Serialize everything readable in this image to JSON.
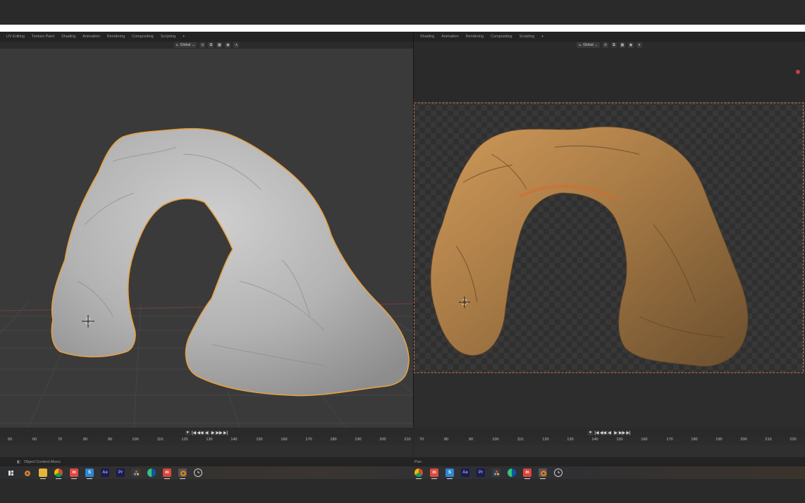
{
  "left_editor": {
    "workspace_tabs": [
      "UV Editing",
      "Texture Paint",
      "Shading",
      "Animation",
      "Rendering",
      "Compositing",
      "Scripting"
    ],
    "add_tab": "+",
    "transform_orientation": "Global",
    "timeline_ticks": [
      "50",
      "60",
      "70",
      "80",
      "90",
      "100",
      "110",
      "120",
      "130",
      "140",
      "150",
      "160",
      "170",
      "180",
      "190",
      "200",
      "210"
    ],
    "status_text": "Object Context Menu"
  },
  "right_editor": {
    "workspace_tabs": [
      "Shading",
      "Animation",
      "Rendering",
      "Compositing",
      "Scripting"
    ],
    "add_tab": "+",
    "transform_orientation": "Global",
    "timeline_ticks": [
      "70",
      "80",
      "90",
      "100",
      "110",
      "120",
      "130",
      "140",
      "150",
      "160",
      "170",
      "180",
      "190",
      "200",
      "210",
      "220"
    ],
    "status_text": "Pan"
  },
  "playback": [
    "●",
    "|◀",
    "◀◀",
    "◀",
    "▶",
    "▶▶",
    "▶|"
  ],
  "taskbar": {
    "left_icons": [
      "task-view-icon",
      "blender-icon",
      "file-explorer-icon",
      "chrome-icon",
      "mail-icon",
      "store-icon",
      "after-effects-icon",
      "premiere-icon",
      "davinci-icon",
      "edge-icon",
      "news-icon",
      "blender-active-icon",
      "clock-icon"
    ],
    "right_icons": [
      "chrome-icon",
      "mail-icon",
      "store-icon",
      "after-effects-icon",
      "premiere-icon",
      "davinci-icon",
      "edge-icon",
      "news-icon",
      "blender-active-icon",
      "clock-icon"
    ],
    "labels": {
      "after_effects": "Ae",
      "premiere": "Pr",
      "store": "S",
      "mail": "m"
    }
  },
  "colors": {
    "selection_outline": "#e8a040",
    "clay": "#b9b9b9",
    "rock": "#a07a48",
    "viewport_grey": "#3a3a3a"
  }
}
